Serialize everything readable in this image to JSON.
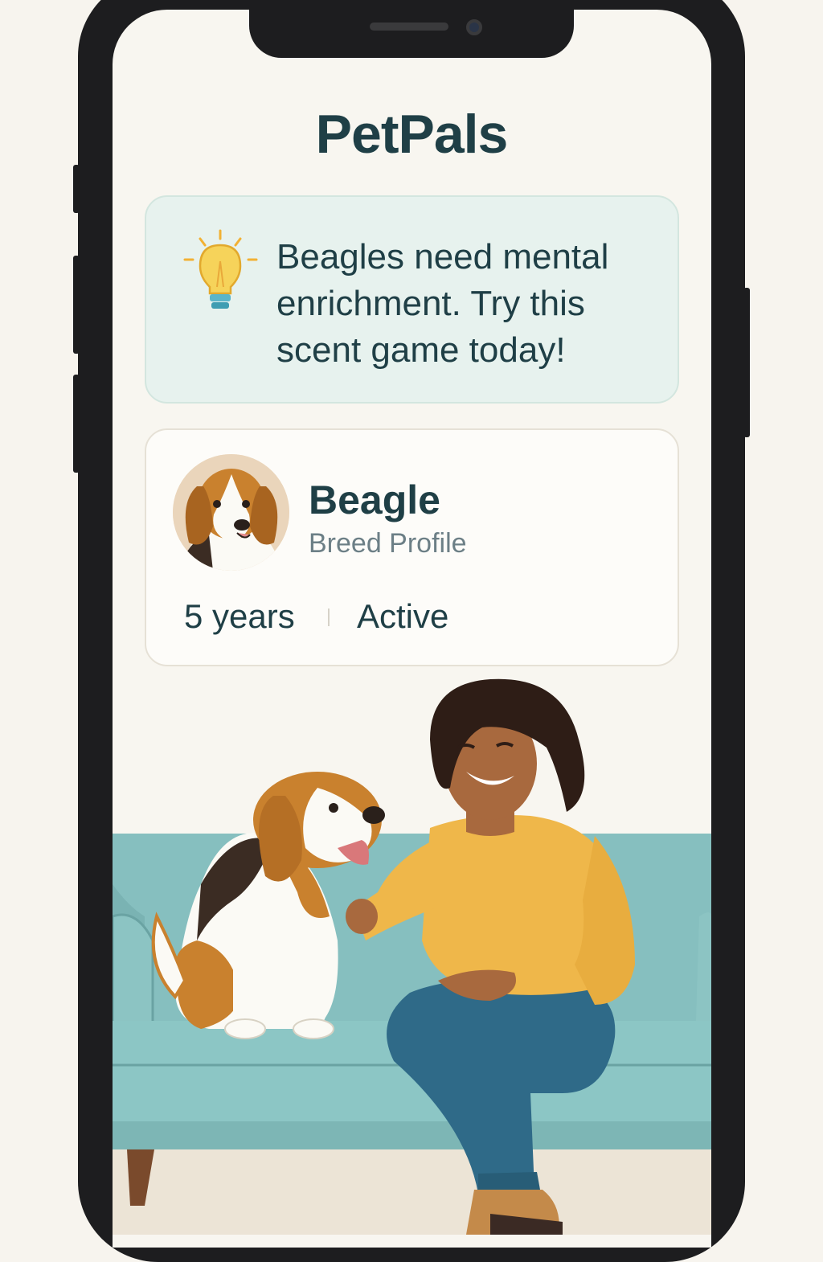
{
  "app": {
    "title": "PetPals"
  },
  "tip": {
    "icon": "lightbulb-icon",
    "text": "Beagles need mental enrichment. Try this scent game today!"
  },
  "breed_card": {
    "name": "Beagle",
    "subtitle": "Breed Profile",
    "stats": {
      "age": "5 years",
      "activity": "Active"
    }
  },
  "colors": {
    "primary_text": "#1f3f46",
    "secondary_text": "#6c7f86",
    "tip_background": "#e7f2ee",
    "card_background": "#fdfcf9",
    "screen_background": "#f8f6f0",
    "sofa": "#86bfbf",
    "sweater": "#efb74a",
    "jeans": "#2f6a88"
  },
  "illustration": {
    "subject": "woman-with-beagle-on-sofa"
  }
}
